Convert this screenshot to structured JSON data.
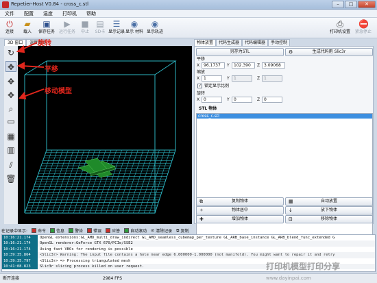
{
  "window": {
    "title": "Repetier-Host V0.84 - cross_c.stl",
    "minimize": "–",
    "maximize": "□",
    "close": "✕"
  },
  "menu": [
    "文件",
    "配置",
    "温度",
    "打印机",
    "帮助"
  ],
  "toolbar": {
    "connect": "连接",
    "load": "载入",
    "save_job": "保存任务",
    "run_job": "运行任务",
    "stop": "中止",
    "sd_card": "SD卡",
    "show_log": "显示记录",
    "show_filament": "显示 材料",
    "show_travel": "显示轨迹",
    "printer_settings": "打印机设置",
    "emergency_stop": "紧急停止"
  },
  "view_tabs": [
    "3D 窗口",
    "温度曲线"
  ],
  "annotations": {
    "rotate": "旋转",
    "pan": "平移",
    "move_model": "移动模型"
  },
  "right_tabs": [
    "物体放置",
    "代码生成器",
    "代码编辑器",
    "手动控制"
  ],
  "object_panel": {
    "save_stl": "另存为STL",
    "generate_code": "生成代码用 Slic3r",
    "translation_label": "平移",
    "translation": {
      "x_label": "X",
      "x": "96.1737",
      "y_label": "Y",
      "y": "102.390",
      "z_label": "Z",
      "z": "3.09068"
    },
    "scale_label": "缩放",
    "scale": {
      "x_label": "X",
      "x": "1",
      "y_label": "Y",
      "y": "1",
      "z_label": "Z",
      "z": "1"
    },
    "lock_aspect": "锁定显示比例",
    "rotation_label": "旋转",
    "rotation": {
      "x_label": "X",
      "x": "0",
      "y_label": "Y",
      "y": "0",
      "z_label": "Z",
      "z": "0"
    },
    "stl_objects": "STL 物体",
    "objects": [
      "cross_c.stl"
    ]
  },
  "object_buttons": {
    "copy": "复制物体",
    "autoplace": "自动放置",
    "center": "物体居中",
    "drop": "放下物体",
    "add": "增加物体",
    "remove": "移除物体"
  },
  "log_filters": {
    "prefix": "在记录中显示:",
    "command": "命令",
    "info": "信息",
    "warning": "警告",
    "error": "错误",
    "ack": "应答",
    "autoscroll": "自动滚动",
    "clear": "清除记录",
    "copy": "复制"
  },
  "log": [
    {
      "time": "10:16:21.174",
      "msg": "OpenGL extensions:GL_AMD_multi_draw_indirect GL_AMD_seamless_cubemap_per_texture GL_ARB_base_instance GL_ARB_blend_func_extended G"
    },
    {
      "time": "10:16:21.174",
      "msg": "OpenGL renderer:GeForce GTX 670/PCIe/SSE2"
    },
    {
      "time": "10:16:21.174",
      "msg": "Using fast VBOs for rendering is possible"
    },
    {
      "time": "10:39:35.864",
      "msg": "<Slic3r> Warning: The input file contains a hole near edge 6.000000-1.000000 (not manifold). You might want to repair it and retry"
    },
    {
      "time": "10:39:35.797",
      "msg": "<Slic3r> => Processing triangulated mesh"
    },
    {
      "time": "10:41:08.823",
      "msg": "Slic3r slicing process killed on user request."
    }
  ],
  "status": {
    "connection": "断开连接",
    "fps": "2984 FPS"
  },
  "watermark": {
    "text": "打印机模型打印分享",
    "url": "www.dayinpai.com"
  },
  "colors": {
    "accent": "#3d8fe0",
    "grid": "#2bb3c0",
    "annotation": "#e0261c"
  }
}
